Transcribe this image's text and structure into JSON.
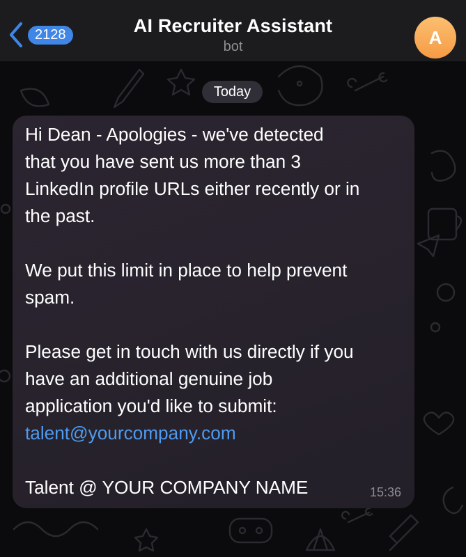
{
  "header": {
    "back_count": "2128",
    "title": "AI Recruiter Assistant",
    "subtitle": "bot",
    "avatar_initial": "A",
    "accent_color": "#3f86e6",
    "avatar_color": "#f69b45"
  },
  "date_divider": "Today",
  "message": {
    "paragraph1": [
      "Hi Dean - Apologies - we've detected",
      "that you have sent us more than 3",
      "LinkedIn profile URLs either recently or in",
      "the past."
    ],
    "paragraph2": [
      "We put this limit in place to help prevent",
      "spam."
    ],
    "paragraph3": [
      "Please get in touch with us directly if you",
      "have an additional genuine job",
      "application you'd like to submit:"
    ],
    "email_link": "talent@yourcompany.com",
    "signature": "Talent @ YOUR COMPANY NAME",
    "time": "15:36",
    "link_color": "#4e9bf0"
  }
}
